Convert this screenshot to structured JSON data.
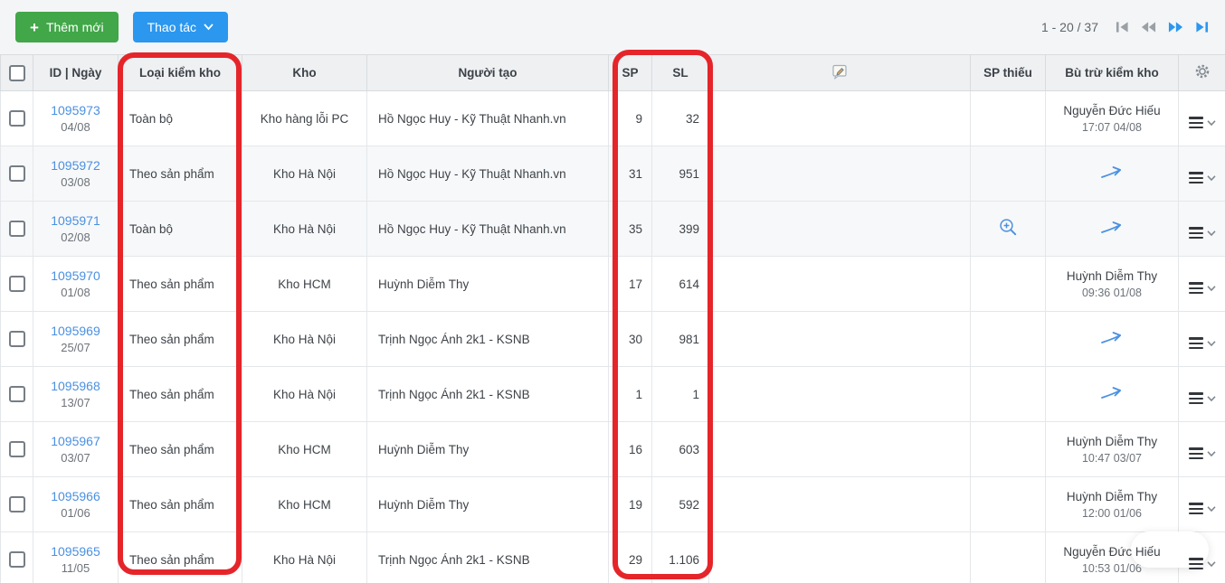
{
  "toolbar": {
    "add_button": "Thêm mới",
    "actions_button": "Thao tác",
    "pagination_label": "1 - 20 / 37"
  },
  "icons": {
    "add_plus": "+",
    "actions_chevron": "chevron-down-icon",
    "note_header": "note-edit-icon",
    "settings": "gear-icon",
    "first_page": "first-page-icon",
    "prev_page": "prev-page-icon",
    "next_page": "next-page-icon",
    "last_page": "last-page-icon",
    "missing": "zoom-in-icon",
    "adjustment_arrow": "arrow-right-icon",
    "row_menu": "menu-icon"
  },
  "colors": {
    "green_button": "#41a748",
    "blue_button": "#2b97ef",
    "link_blue": "#4a90e2",
    "annotation_red": "#e5252a"
  },
  "table": {
    "headers": {
      "id_date": "ID | Ngày",
      "type": "Loại kiểm kho",
      "warehouse": "Kho",
      "creator": "Người tạo",
      "sp": "SP",
      "sl": "SL",
      "missing": "SP thiếu",
      "adjustment": "Bù trừ kiểm kho"
    },
    "rows": [
      {
        "id": "1095973",
        "date": "04/08",
        "type": "Toàn bộ",
        "warehouse": "Kho hàng lỗi PC",
        "creator": "Hồ Ngọc Huy - Kỹ Thuật Nhanh.vn",
        "sp": "9",
        "sl": "32",
        "missing_icon": false,
        "adj": {
          "kind": "text",
          "name": "Nguyễn Đức Hiếu",
          "time": "17:07 04/08"
        },
        "shaded": false
      },
      {
        "id": "1095972",
        "date": "03/08",
        "type": "Theo sản phẩm",
        "warehouse": "Kho Hà Nội",
        "creator": "Hồ Ngọc Huy - Kỹ Thuật Nhanh.vn",
        "sp": "31",
        "sl": "951",
        "missing_icon": false,
        "adj": {
          "kind": "arrow"
        },
        "shaded": true
      },
      {
        "id": "1095971",
        "date": "02/08",
        "type": "Toàn bộ",
        "warehouse": "Kho Hà Nội",
        "creator": "Hồ Ngọc Huy - Kỹ Thuật Nhanh.vn",
        "sp": "35",
        "sl": "399",
        "missing_icon": true,
        "adj": {
          "kind": "arrow"
        },
        "shaded": true
      },
      {
        "id": "1095970",
        "date": "01/08",
        "type": "Theo sản phẩm",
        "warehouse": "Kho HCM",
        "creator": "Huỳnh Diễm Thy",
        "sp": "17",
        "sl": "614",
        "missing_icon": false,
        "adj": {
          "kind": "text",
          "name": "Huỳnh Diễm Thy",
          "time": "09:36 01/08"
        },
        "shaded": false
      },
      {
        "id": "1095969",
        "date": "25/07",
        "type": "Theo sản phẩm",
        "warehouse": "Kho Hà Nội",
        "creator": "Trịnh Ngọc Ánh 2k1 - KSNB",
        "sp": "30",
        "sl": "981",
        "missing_icon": false,
        "adj": {
          "kind": "arrow"
        },
        "shaded": false
      },
      {
        "id": "1095968",
        "date": "13/07",
        "type": "Theo sản phẩm",
        "warehouse": "Kho Hà Nội",
        "creator": "Trịnh Ngọc Ánh 2k1 - KSNB",
        "sp": "1",
        "sl": "1",
        "missing_icon": false,
        "adj": {
          "kind": "arrow"
        },
        "shaded": false
      },
      {
        "id": "1095967",
        "date": "03/07",
        "type": "Theo sản phẩm",
        "warehouse": "Kho HCM",
        "creator": "Huỳnh Diễm Thy",
        "sp": "16",
        "sl": "603",
        "missing_icon": false,
        "adj": {
          "kind": "text",
          "name": "Huỳnh Diễm Thy",
          "time": "10:47 03/07"
        },
        "shaded": false
      },
      {
        "id": "1095966",
        "date": "01/06",
        "type": "Theo sản phẩm",
        "warehouse": "Kho HCM",
        "creator": "Huỳnh Diễm Thy",
        "sp": "19",
        "sl": "592",
        "missing_icon": false,
        "adj": {
          "kind": "text",
          "name": "Huỳnh Diễm Thy",
          "time": "12:00 01/06"
        },
        "shaded": false
      },
      {
        "id": "1095965",
        "date": "11/05",
        "type": "Theo sản phẩm",
        "warehouse": "Kho Hà Nội",
        "creator": "Trịnh Ngọc Ánh 2k1 - KSNB",
        "sp": "29",
        "sl": "1.106",
        "missing_icon": false,
        "adj": {
          "kind": "text",
          "name": "Nguyễn Đức Hiếu",
          "time": "10:53 01/06"
        },
        "shaded": false
      }
    ]
  },
  "annotations": {
    "color": "#e5252a",
    "boxes": [
      "type-column-highlight",
      "sp-sl-columns-highlight"
    ]
  }
}
